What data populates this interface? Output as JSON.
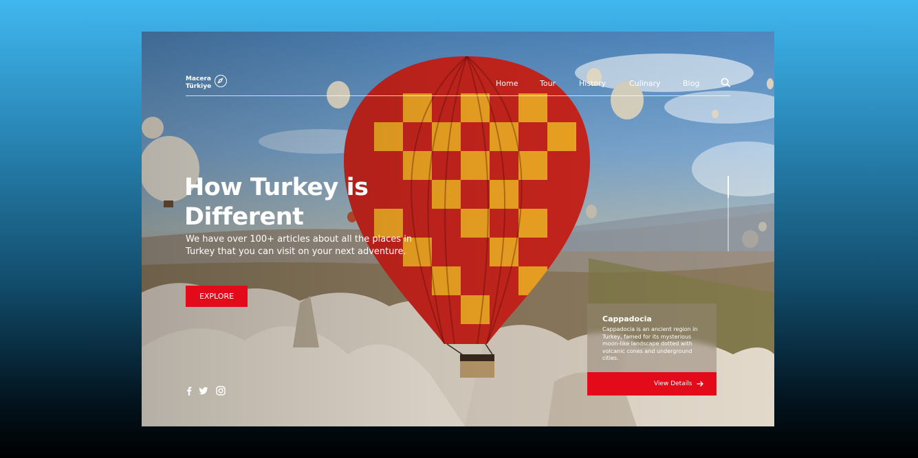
{
  "brand": {
    "line1": "Macera",
    "line2": "Türkiye",
    "icon": "compass-icon"
  },
  "nav": {
    "items": [
      {
        "label": "Home",
        "active": true
      },
      {
        "label": "Tour",
        "active": false
      },
      {
        "label": "History",
        "active": false
      },
      {
        "label": "Culinary",
        "active": false
      },
      {
        "label": "Blog",
        "active": false
      }
    ],
    "search_icon": "search-icon",
    "accent": "#e30a1a"
  },
  "hero": {
    "title": "How Turkey is Different",
    "subtitle": "We have over 100+ articles about all the places in Turkey that you can visit on your next adventure.",
    "button_label": "EXPLORE"
  },
  "social": [
    "facebook-icon",
    "twitter-icon",
    "instagram-icon"
  ],
  "card": {
    "title": "Cappadocia",
    "text": "Cappadocia is an ancient region in Turkey, famed for its mysterious moon-like landscape dotted with volcanic cones and underground cities.",
    "button_label": "View Details",
    "button_icon": "arrow-right-icon"
  },
  "colors": {
    "accent": "#e30a1a",
    "page_bg_top": "#40b7ef",
    "page_bg_bottom": "#000000"
  }
}
